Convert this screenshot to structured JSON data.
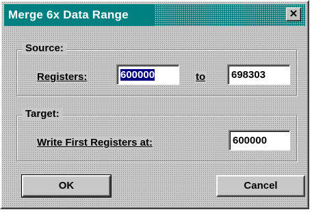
{
  "window": {
    "title": "Merge 6x Data Range",
    "close_glyph": "✕"
  },
  "source": {
    "legend": "Source:",
    "registers_label": "Registers:",
    "from_value": "600000",
    "to_label": "to",
    "to_value": "698303"
  },
  "target": {
    "legend": "Target:",
    "write_label": "Write First Registers at:",
    "write_value": "600000"
  },
  "buttons": {
    "ok": "OK",
    "cancel": "Cancel"
  },
  "colors": {
    "titlebar": "#008080",
    "selection": "#000080",
    "dialog_face": "#c8c8c8"
  }
}
